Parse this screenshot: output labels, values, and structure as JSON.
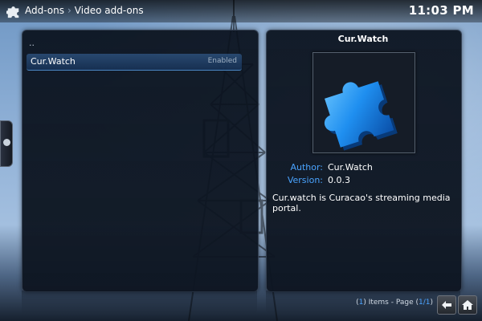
{
  "header": {
    "crumbs": [
      "Add-ons",
      "Video add-ons"
    ],
    "separator": "›",
    "clock": "11:03 PM",
    "icon": "puzzle-icon"
  },
  "list": {
    "parent_label": "..",
    "items": [
      {
        "name": "Cur.Watch",
        "status": "Enabled"
      }
    ]
  },
  "detail": {
    "title": "Cur.Watch",
    "thumbnail_icon": "puzzle-piece-icon",
    "author_label": "Author:",
    "author": "Cur.Watch",
    "version_label": "Version:",
    "version": "0.0.3",
    "description": "Cur.watch is Curacao's streaming media portal."
  },
  "footer": {
    "count": "1",
    "items_text": " Items - Page (",
    "page": "1/1",
    "close_paren": ")",
    "back_icon": "back-arrow-icon",
    "home_icon": "home-icon"
  },
  "colors": {
    "accent": "#4aa3ff",
    "panel": "#0e1622"
  }
}
